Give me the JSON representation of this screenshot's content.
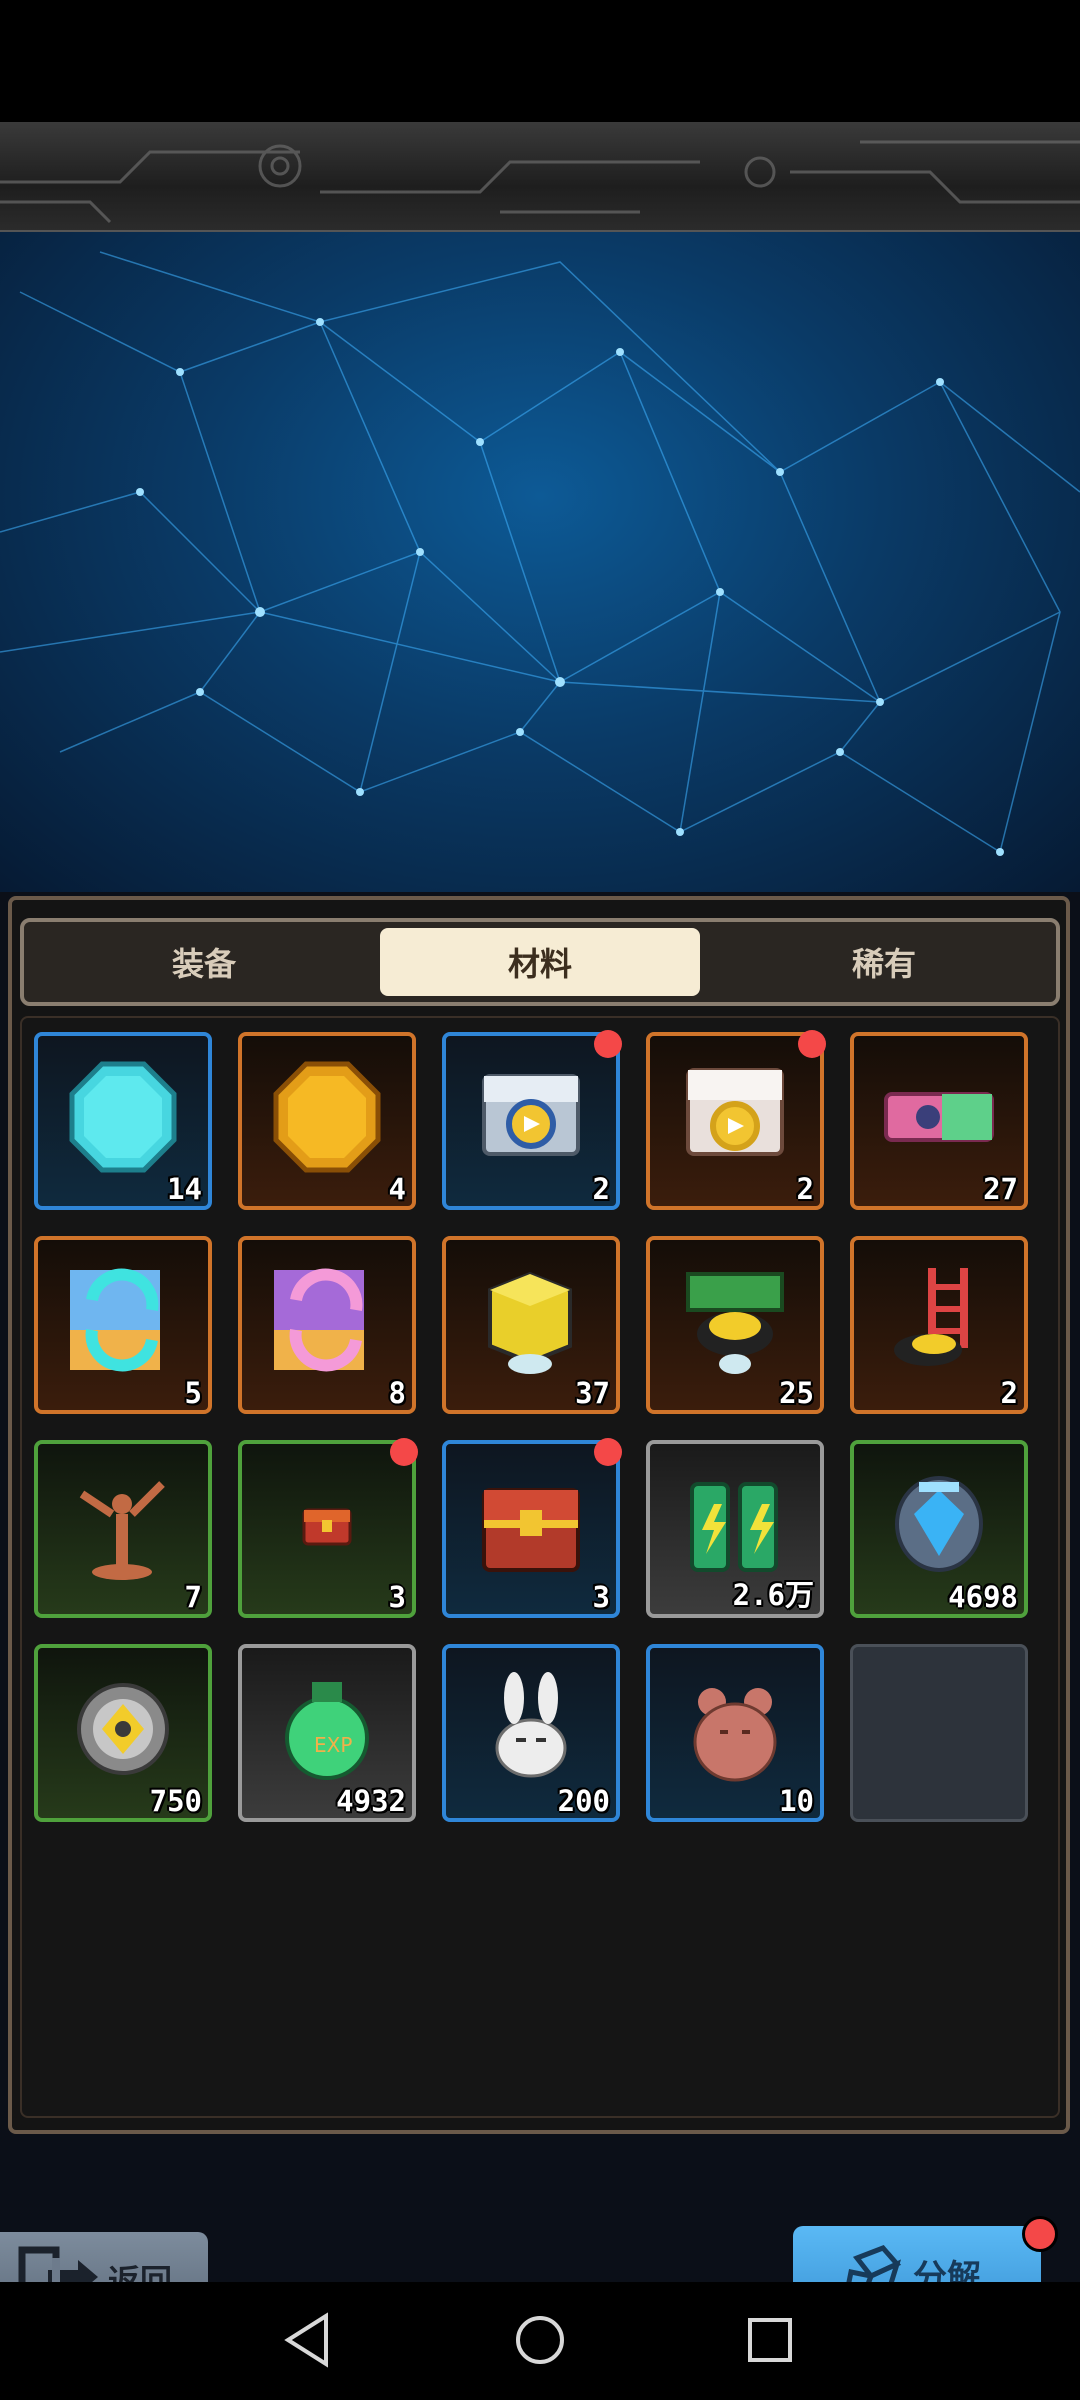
{
  "tabs": [
    {
      "label": "装备",
      "active": false
    },
    {
      "label": "材料",
      "active": true
    },
    {
      "label": "稀有",
      "active": false
    }
  ],
  "items": [
    {
      "icon": "cyan-gem-icon",
      "qty": "14",
      "rarity": "blue",
      "badge": false
    },
    {
      "icon": "gold-coin-icon",
      "qty": "4",
      "rarity": "orange",
      "badge": false
    },
    {
      "icon": "silver-chest-icon",
      "qty": "2",
      "rarity": "blue",
      "badge": true
    },
    {
      "icon": "white-chest-icon",
      "qty": "2",
      "rarity": "orange",
      "badge": true
    },
    {
      "icon": "pink-ticket-icon",
      "qty": "27",
      "rarity": "orange",
      "badge": false
    },
    {
      "icon": "cyan-exchange-icon",
      "qty": "5",
      "rarity": "orange",
      "badge": false
    },
    {
      "icon": "pink-exchange-icon",
      "qty": "8",
      "rarity": "orange",
      "badge": false
    },
    {
      "icon": "gold-cube-icon",
      "qty": "37",
      "rarity": "orange",
      "badge": false
    },
    {
      "icon": "green-board-icon",
      "qty": "25",
      "rarity": "orange",
      "badge": false
    },
    {
      "icon": "ladder-icon",
      "qty": "2",
      "rarity": "orange",
      "badge": false
    },
    {
      "icon": "bronze-statue-icon",
      "qty": "7",
      "rarity": "green",
      "badge": false
    },
    {
      "icon": "small-chest-icon",
      "qty": "3",
      "rarity": "green",
      "badge": true
    },
    {
      "icon": "red-treasure-chest-icon",
      "qty": "3",
      "rarity": "blue",
      "badge": true
    },
    {
      "icon": "battery-icon",
      "qty": "2.6万",
      "rarity": "gray",
      "badge": false
    },
    {
      "icon": "blue-crystal-icon",
      "qty": "4698",
      "rarity": "green",
      "badge": false
    },
    {
      "icon": "gear-icon",
      "qty": "750",
      "rarity": "green",
      "badge": false
    },
    {
      "icon": "green-potion-icon",
      "qty": "4932",
      "rarity": "gray",
      "badge": false
    },
    {
      "icon": "white-bunny-icon",
      "qty": "200",
      "rarity": "blue",
      "badge": false
    },
    {
      "icon": "teddy-bear-icon",
      "qty": "10",
      "rarity": "blue",
      "badge": false
    },
    {
      "icon": "",
      "qty": "",
      "rarity": "empty",
      "badge": false
    }
  ],
  "buttons": {
    "back_label": "返回",
    "decompose_label": "分解",
    "decompose_badge": true
  },
  "colors": {
    "badge": "#f44848",
    "blue_rarity": "#2f86d8",
    "orange_rarity": "#d0742a",
    "green_rarity": "#4fa13c",
    "gray_rarity": "#9a9a9a"
  }
}
